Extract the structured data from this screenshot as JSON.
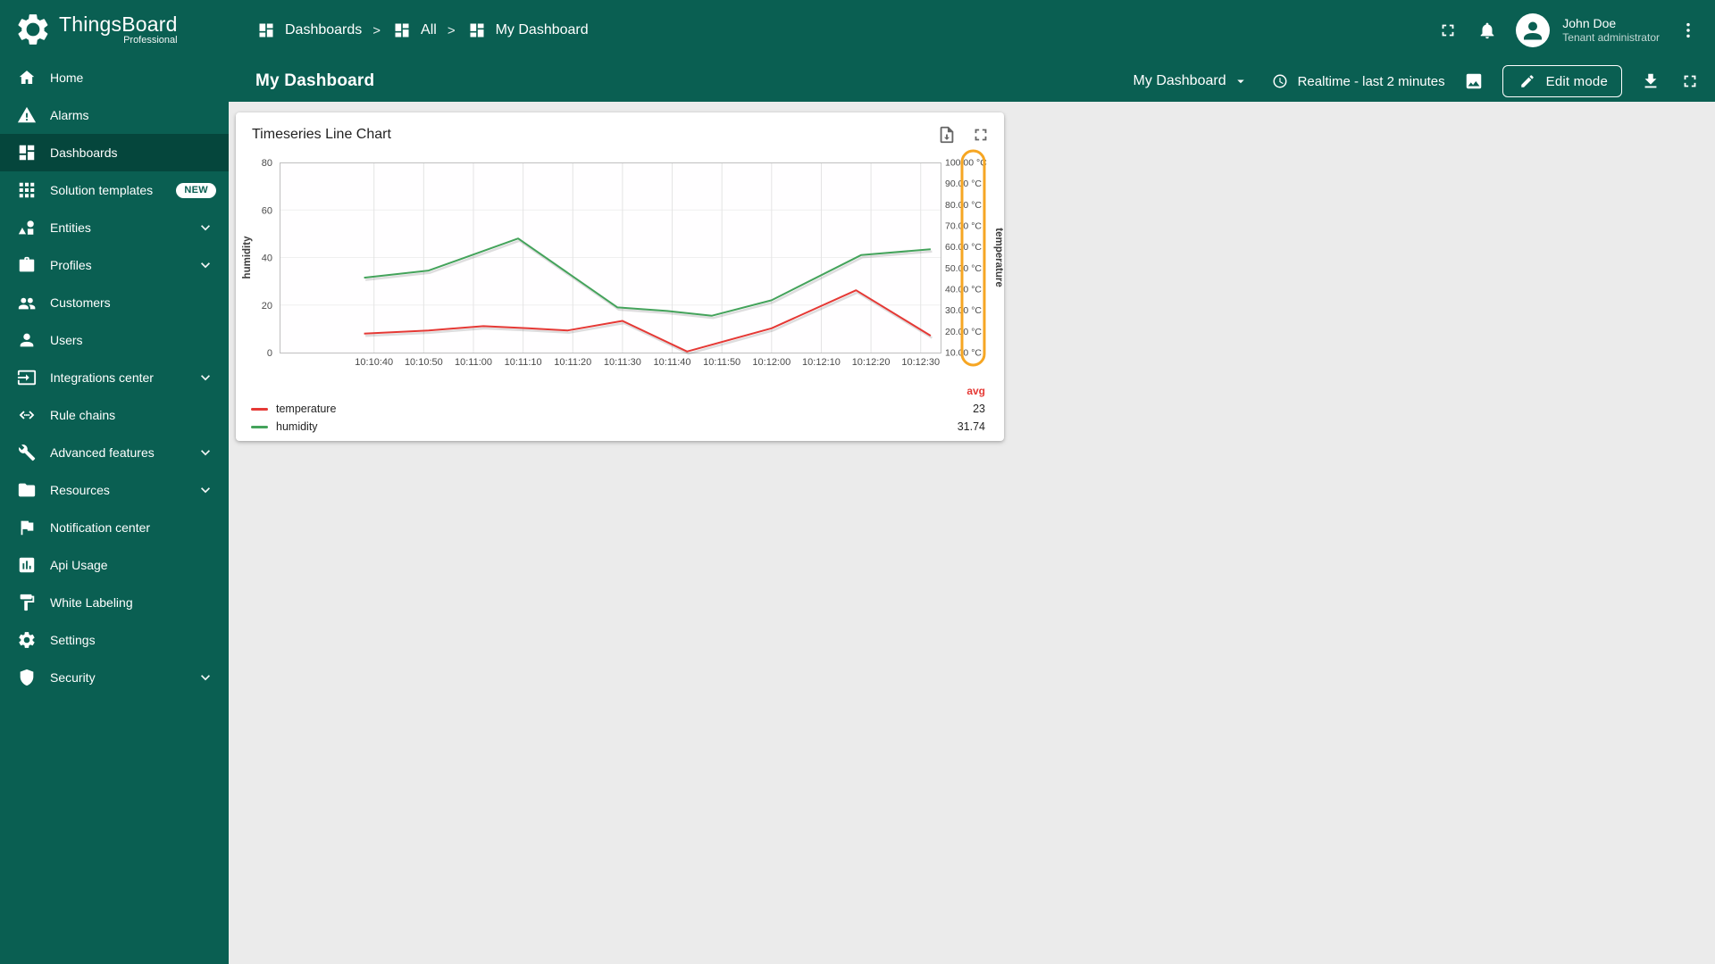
{
  "app": {
    "name": "ThingsBoard",
    "edition": "Professional"
  },
  "colors": {
    "brand": "#0a5f52",
    "brand_dark": "#05463c",
    "content_background": "#ebebeb",
    "annotation_highlight": "#f6a623",
    "temperature_series": "#e53935",
    "humidity_series": "#44a35b",
    "avg_header": "#e53935"
  },
  "sidebar": {
    "items": [
      {
        "label": "Home",
        "icon": "home"
      },
      {
        "label": "Alarms",
        "icon": "alarm"
      },
      {
        "label": "Dashboards",
        "icon": "dashboards",
        "active": true
      },
      {
        "label": "Solution templates",
        "icon": "templates",
        "badge": "NEW"
      },
      {
        "label": "Entities",
        "icon": "entities",
        "expandable": true
      },
      {
        "label": "Profiles",
        "icon": "profiles",
        "expandable": true
      },
      {
        "label": "Customers",
        "icon": "customers"
      },
      {
        "label": "Users",
        "icon": "users"
      },
      {
        "label": "Integrations center",
        "icon": "integrations",
        "expandable": true
      },
      {
        "label": "Rule chains",
        "icon": "rulechains"
      },
      {
        "label": "Advanced features",
        "icon": "advanced",
        "expandable": true
      },
      {
        "label": "Resources",
        "icon": "resources",
        "expandable": true
      },
      {
        "label": "Notification center",
        "icon": "notification"
      },
      {
        "label": "Api Usage",
        "icon": "api"
      },
      {
        "label": "White Labeling",
        "icon": "whitelabel"
      },
      {
        "label": "Settings",
        "icon": "settings"
      },
      {
        "label": "Security",
        "icon": "security",
        "expandable": true
      }
    ]
  },
  "header": {
    "breadcrumb": [
      {
        "label": "Dashboards"
      },
      {
        "label": "All"
      },
      {
        "label": "My Dashboard"
      }
    ],
    "user": {
      "name": "John Doe",
      "role": "Tenant administrator"
    }
  },
  "toolbar": {
    "title": "My Dashboard",
    "state_selector": "My Dashboard",
    "time_window": "Realtime - last 2 minutes",
    "edit_button": "Edit mode"
  },
  "widget": {
    "title": "Timeseries Line Chart"
  },
  "chart_data": {
    "type": "line",
    "title": "Timeseries Line Chart",
    "x_domain_seconds": [
      0,
      133
    ],
    "x_ticks": [
      {
        "s": 19,
        "label": "10:10:40"
      },
      {
        "s": 29,
        "label": "10:10:50"
      },
      {
        "s": 39,
        "label": "10:11:00"
      },
      {
        "s": 49,
        "label": "10:11:10"
      },
      {
        "s": 59,
        "label": "10:11:20"
      },
      {
        "s": 69,
        "label": "10:11:30"
      },
      {
        "s": 79,
        "label": "10:11:40"
      },
      {
        "s": 89,
        "label": "10:11:50"
      },
      {
        "s": 99,
        "label": "10:12:00"
      },
      {
        "s": 109,
        "label": "10:12:10"
      },
      {
        "s": 119,
        "label": "10:12:20"
      },
      {
        "s": 129,
        "label": "10:12:30"
      }
    ],
    "left_axis": {
      "title": "humidity",
      "min": 0,
      "max": 80,
      "ticks": [
        0,
        20,
        40,
        60,
        80
      ]
    },
    "right_axis": {
      "title": "temperature",
      "min": 10,
      "max": 100,
      "tick_labels": [
        "100.00 °C",
        "90.00 °C",
        "80.00 °C",
        "70.00 °C",
        "60.00 °C",
        "50.00 °C",
        "40.00 °C",
        "30.00 °C",
        "20.00 °C",
        "10.00 °C"
      ],
      "highlighted": true
    },
    "series": [
      {
        "name": "temperature",
        "color": "#e53935",
        "axis": "right",
        "avg": "23",
        "points": [
          [
            17,
            19
          ],
          [
            30,
            20.5
          ],
          [
            41,
            22.5
          ],
          [
            50,
            21.5
          ],
          [
            58,
            20.5
          ],
          [
            69,
            25
          ],
          [
            82,
            10.5
          ],
          [
            99,
            21.5
          ],
          [
            116,
            39.5
          ],
          [
            131,
            18
          ]
        ]
      },
      {
        "name": "humidity",
        "color": "#44a35b",
        "axis": "left",
        "avg": "31.74",
        "points": [
          [
            17,
            31.5
          ],
          [
            30,
            34.5
          ],
          [
            48,
            48
          ],
          [
            68,
            19
          ],
          [
            78,
            17.5
          ],
          [
            87,
            15.5
          ],
          [
            99,
            22
          ],
          [
            117,
            41
          ],
          [
            131,
            43.5
          ]
        ]
      }
    ],
    "legend_avg_label": "avg",
    "grid": true,
    "legend_position": "bottom"
  }
}
